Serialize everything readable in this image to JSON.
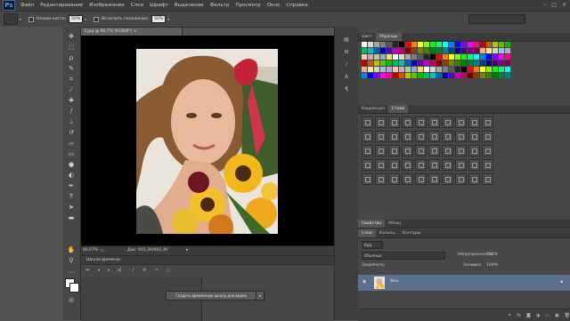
{
  "app": {
    "logo": "Ps"
  },
  "menu": [
    "Файл",
    "Редактирование",
    "Изображение",
    "Слои",
    "Шрифт",
    "Выделение",
    "Фильтр",
    "Просмотр",
    "Окно",
    "Справка"
  ],
  "options": {
    "opacity_label": "Нажим кисти:",
    "opacity_value": "50%",
    "flow_label": "Включить наложение:",
    "flow_value": "50%"
  },
  "document": {
    "tab_title": "3.jpg @ 66,7% (RGB/8*)",
    "zoom": "66,67%",
    "doc_size": "Док: 902,3К/902,3К"
  },
  "timeline": {
    "header": "Шкала времени",
    "create_button": "Создать временную шкалу для видео"
  },
  "panels": {
    "color_tabs": [
      "Цвет",
      "Образцы"
    ],
    "style_tabs": [
      "Коррекция",
      "Стили"
    ],
    "layer_group_tabs": [
      "Свойства",
      "Абзац"
    ],
    "layer_tabs": [
      "Слои",
      "Каналы",
      "Контуры"
    ],
    "layer_filter": "Вид",
    "blend_mode": "Обычные",
    "opacity_label": "Непрозрачность:",
    "opacity_value": "100%",
    "lock_label": "Закрепить:",
    "fill_label": "Заливка:",
    "fill_value": "100%",
    "layer_name": "Фон"
  },
  "colors": {
    "layer_selected": "#5b6f8e",
    "accent": "#4aa3df"
  }
}
